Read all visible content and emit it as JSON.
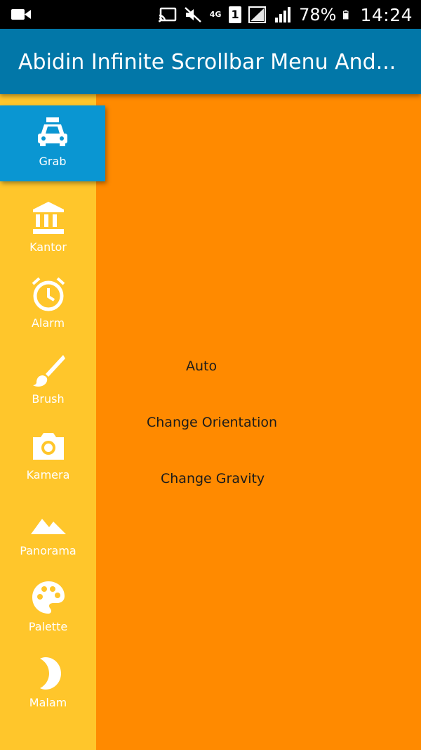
{
  "status_bar": {
    "network": "4G",
    "sim": "1",
    "battery": "78%",
    "time": "14:24"
  },
  "app_bar": {
    "title": "Abidin Infinite Scrollbar Menu And..."
  },
  "menu": {
    "items": [
      {
        "label": "Grab",
        "icon": "taxi-icon",
        "active": true
      },
      {
        "label": "Kantor",
        "icon": "bank-icon",
        "active": false
      },
      {
        "label": "Alarm",
        "icon": "alarm-clock-icon",
        "active": false
      },
      {
        "label": "Brush",
        "icon": "brush-icon",
        "active": false
      },
      {
        "label": "Kamera",
        "icon": "camera-icon",
        "active": false
      },
      {
        "label": "Panorama",
        "icon": "landscape-icon",
        "active": false
      },
      {
        "label": "Palette",
        "icon": "palette-icon",
        "active": false
      },
      {
        "label": "Malam",
        "icon": "moon-icon",
        "active": false
      }
    ]
  },
  "actions": {
    "auto": "Auto",
    "change_orientation": "Change Orientation",
    "change_gravity": "Change Gravity"
  },
  "colors": {
    "status_bar": "#000000",
    "app_bar": "#0277a8",
    "sidebar": "#ffc62b",
    "sidebar_active": "#0a96d2",
    "content": "#ff8a00"
  }
}
